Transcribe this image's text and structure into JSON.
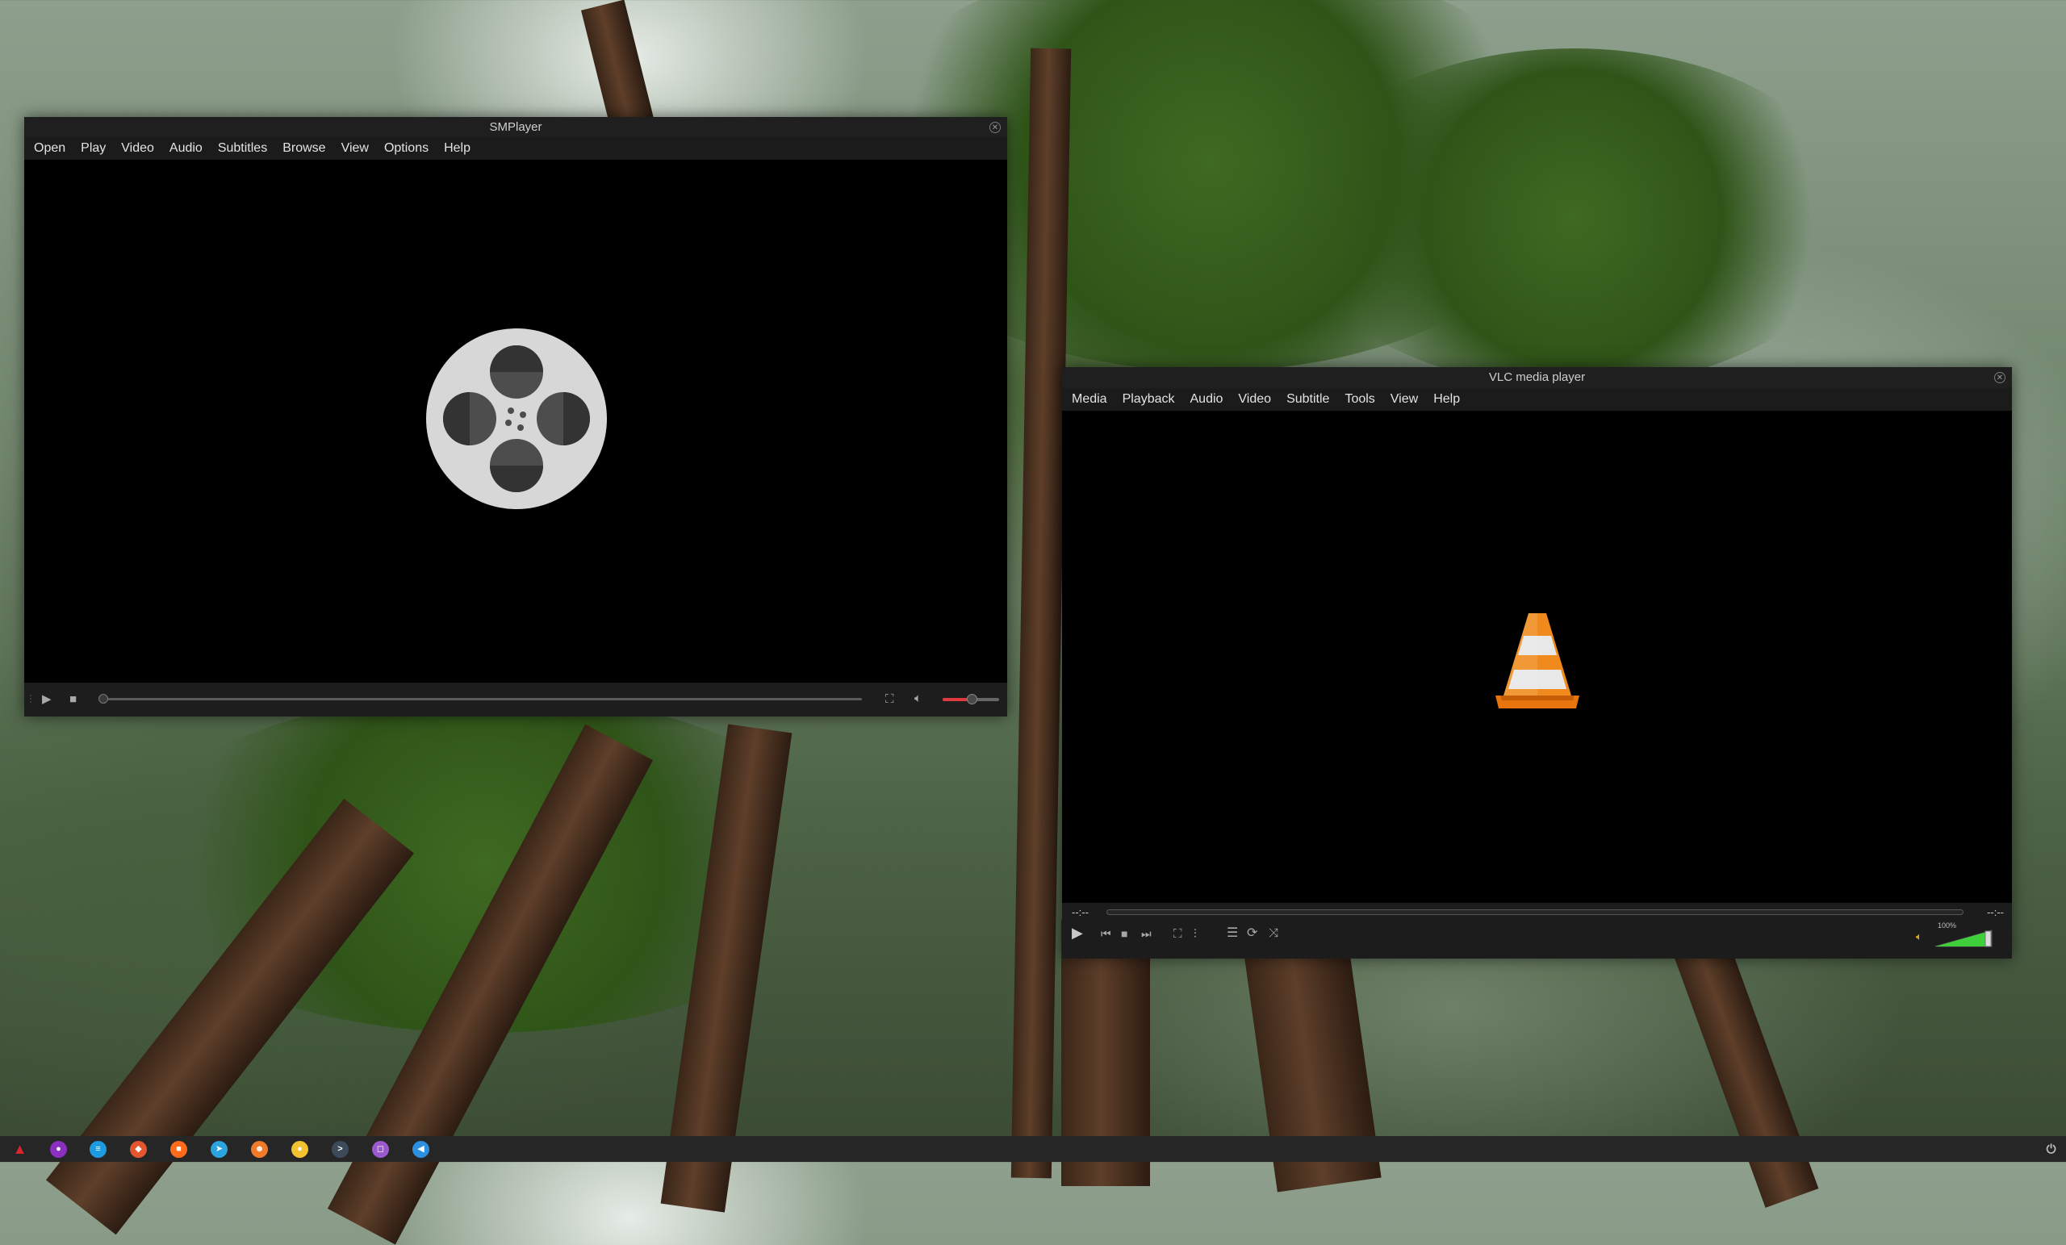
{
  "smplayer": {
    "title": "SMPlayer",
    "menus": [
      "Open",
      "Play",
      "Video",
      "Audio",
      "Subtitles",
      "Browse",
      "View",
      "Options",
      "Help"
    ],
    "volume_level": 0.55,
    "seek_position": 0.0
  },
  "vlc": {
    "title": "VLC media player",
    "menus": [
      "Media",
      "Playback",
      "Audio",
      "Video",
      "Subtitle",
      "Tools",
      "View",
      "Help"
    ],
    "time_elapsed": "--:--",
    "time_total": "--:--",
    "volume_label": "100%",
    "volume_level": 1.0
  },
  "taskbar": {
    "apps": [
      {
        "name": "arch-menu-icon",
        "color": "#d9262c",
        "glyph": "▲"
      },
      {
        "name": "firefox-icon",
        "color": "#8a2fbf",
        "glyph": "●"
      },
      {
        "name": "browser-icon",
        "color": "#1d9be0",
        "glyph": "≡"
      },
      {
        "name": "app-orange-icon",
        "color": "#e4572e",
        "glyph": "◆"
      },
      {
        "name": "video-call-icon",
        "color": "#ff6b1a",
        "glyph": "■"
      },
      {
        "name": "telegram-icon",
        "color": "#2aa3df",
        "glyph": "➤"
      },
      {
        "name": "app-people-icon",
        "color": "#f07a2a",
        "glyph": "☻"
      },
      {
        "name": "notes-icon",
        "color": "#f2c230",
        "glyph": "●"
      },
      {
        "name": "terminal-icon",
        "color": "#3c4a5a",
        "glyph": ">"
      },
      {
        "name": "screenshot-icon",
        "color": "#9b59d0",
        "glyph": "◻"
      },
      {
        "name": "vscode-icon",
        "color": "#2d8fe0",
        "glyph": "◀"
      }
    ],
    "power_icon": "power-icon"
  }
}
